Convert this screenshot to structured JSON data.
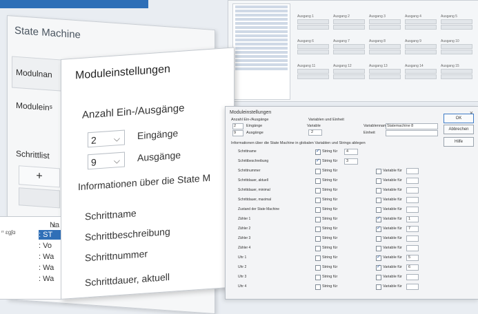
{
  "state_machine": {
    "title": "State Machine",
    "rows": [
      "Modulnan",
      "Moduleinˢ",
      "Schrittlist"
    ],
    "add_button": "+"
  },
  "module_settings": {
    "title": "Moduleinstellungen",
    "io_header": "Anzahl Ein-/Ausgänge",
    "inputs_value": "2",
    "inputs_label": "Eingänge",
    "outputs_value": "9",
    "outputs_label": "Ausgänge",
    "info": "Informationen über die State M",
    "fields": [
      "Schrittname",
      "Schrittbeschreibung",
      "Schrittnummer",
      "Schrittdauer, aktuell"
    ]
  },
  "step_table": {
    "header": "Na",
    "tag": "ʳʳ ɛɡʃɑ",
    "rows": [
      ": ST",
      ": Vo",
      ": Wa",
      ": Wa",
      ": Wa"
    ],
    "close": "×"
  },
  "thumbnail": {
    "group_labels": [
      "Ausgang 1",
      "Ausgang 2",
      "Ausgang 3",
      "Ausgang 4",
      "Ausgang 5",
      "Ausgang 6",
      "Ausgang 7",
      "Ausgang 8",
      "Ausgang 9",
      "Ausgang 10",
      "Ausgang 11",
      "Ausgang 12",
      "Ausgang 13",
      "Ausgang 14",
      "Ausgang 15"
    ]
  },
  "dialog": {
    "title": "Moduleinstellungen",
    "close": "×",
    "buttons": [
      "OK",
      "Abbrechen",
      "Hilfe"
    ],
    "io_header": "Anzahl Ein-/Ausgänge",
    "io_inputs_value": "2",
    "io_inputs_label": "Eingänge",
    "io_outputs_value": "9",
    "io_outputs_label": "Ausgänge",
    "var_header": "Variablen und Einheit",
    "variable_label": "Variable",
    "variable_value": "2",
    "varname_label": "Variablenname",
    "varname_value": "Statemachine 8",
    "unit_label": "Einheit",
    "info_line": "Informationen über die State Machine in globalen Variablen und Strings ablegen",
    "rows": [
      {
        "label": "Schrittname",
        "string": true,
        "string_value": "4",
        "var": null
      },
      {
        "label": "Schrittbeschreibung",
        "string": true,
        "string_value": "3",
        "var": null
      },
      {
        "label": "Schrittnummer",
        "string": false,
        "var": false
      },
      {
        "label": "Schrittdauer, aktuell",
        "string": false,
        "var": false
      },
      {
        "label": "Schrittdauer, minimal",
        "string": false,
        "var": false
      },
      {
        "label": "Schrittdauer, maximal",
        "string": false,
        "var": false
      },
      {
        "label": "Zustand der State Machine",
        "string": false,
        "var": false
      },
      {
        "label": "Zähler 1",
        "string": false,
        "var": true,
        "var_value": "1"
      },
      {
        "label": "Zähler 2",
        "string": false,
        "var": true,
        "var_value": "7"
      },
      {
        "label": "Zähler 3",
        "string": false,
        "var": false
      },
      {
        "label": "Zähler 4",
        "string": false,
        "var": false
      },
      {
        "label": "Uhr 1",
        "string": false,
        "var": true,
        "var_value": "5"
      },
      {
        "label": "Uhr 2",
        "string": false,
        "var": true,
        "var_value": "6"
      },
      {
        "label": "Uhr 3",
        "string": false,
        "var": false
      },
      {
        "label": "Uhr 4",
        "string": false,
        "var": false
      }
    ],
    "string_for": "String für",
    "variable_for": "Variable für"
  }
}
